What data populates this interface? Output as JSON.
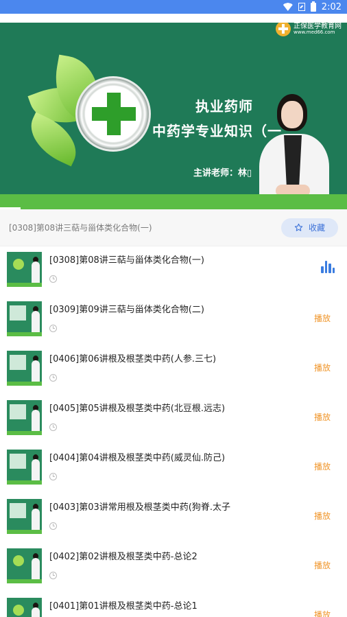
{
  "status_bar": {
    "time": "2:02"
  },
  "video": {
    "logo_text": "正保医学教育网",
    "logo_url": "www.med66.com",
    "slide_title": "执业药师",
    "slide_subtitle": "中药学专业知识（一",
    "slide_teacher": "主讲老师：林▯"
  },
  "info": {
    "current_title": "[0308]第08讲三萜与甾体类化合物(一)",
    "fav_label": "收藏"
  },
  "colors": {
    "accent": "#3b7de0",
    "play": "#f0962b",
    "status_bar": "#4b87ee",
    "video_bg": "#1f7a57"
  },
  "lessons": [
    {
      "title": "[0308]第08讲三萜与甾体类化合物(一)",
      "action": "",
      "playing": true
    },
    {
      "title": "[0309]第09讲三萜与甾体类化合物(二)",
      "action": "播放"
    },
    {
      "title": "[0406]第06讲根及根茎类中药(人参.三七)",
      "action": "播放"
    },
    {
      "title": "[0405]第05讲根及根茎类中药(北豆根.远志)",
      "action": "播放"
    },
    {
      "title": "[0404]第04讲根及根茎类中药(威灵仙.防己)",
      "action": "播放"
    },
    {
      "title": "[0403]第03讲常用根及根茎类中药(狗脊.太子",
      "action": "播放"
    },
    {
      "title": "[0402]第02讲根及根茎类中药-总论2",
      "action": "播放"
    },
    {
      "title": "[0401]第01讲根及根茎类中药-总论1",
      "action": "播放"
    }
  ]
}
